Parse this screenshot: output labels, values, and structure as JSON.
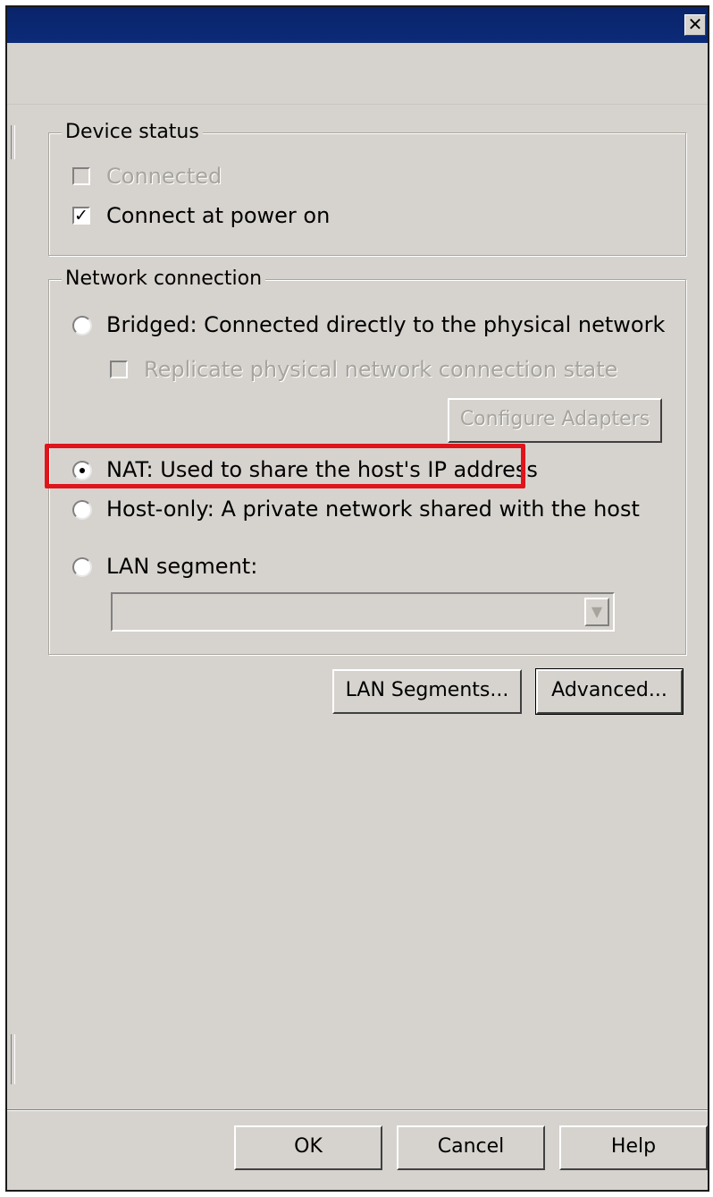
{
  "window": {
    "close_glyph": "✕"
  },
  "device_status": {
    "legend": "Device status",
    "connected_label": "Connected",
    "connected_checked": false,
    "connect_at_power_on_label": "Connect at power on",
    "connect_at_power_on_checked": true
  },
  "network_connection": {
    "legend": "Network connection",
    "bridged_label": "Bridged: Connected directly to the physical network",
    "replicate_label": "Replicate physical network connection state",
    "configure_adapters_label": "Configure Adapters",
    "nat_label": "NAT: Used to share the host's IP address",
    "host_only_label": "Host-only: A private network shared with the host",
    "lan_segment_label": "LAN segment:",
    "lan_segment_value": "",
    "selected": "NAT"
  },
  "buttons": {
    "lan_segments": "LAN Segments...",
    "advanced": "Advanced...",
    "ok": "OK",
    "cancel": "Cancel",
    "help": "Help"
  },
  "colors": {
    "highlight": "#e0141b",
    "titlebar": "#0a246a",
    "dialog_bg": "#d6d3ce"
  }
}
